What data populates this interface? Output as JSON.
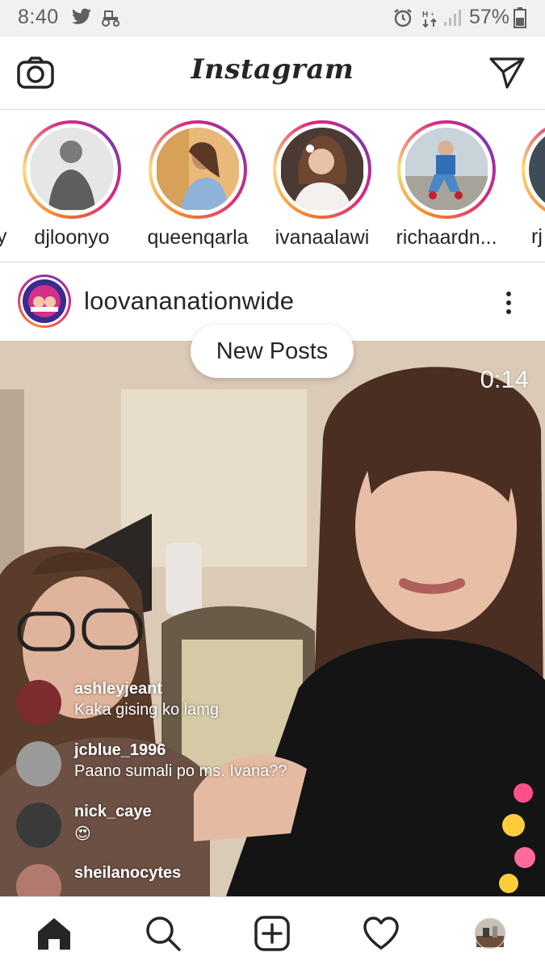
{
  "status_bar": {
    "time": "8:40",
    "battery": "57%",
    "icons": [
      "twitter-icon",
      "tractor-icon",
      "alarm-icon",
      "data-arrows-icon",
      "signal-icon",
      "battery-icon"
    ]
  },
  "header": {
    "brand": "Instagram",
    "left_icon": "camera-icon",
    "right_icon": "direct-message-icon"
  },
  "stories": {
    "partial_left_name": "y",
    "items": [
      {
        "username": "djloonyo"
      },
      {
        "username": "queenqarla"
      },
      {
        "username": "ivanaalawi"
      },
      {
        "username": "richaardn..."
      }
    ],
    "partial_right_name": "rj"
  },
  "post": {
    "username": "loovananationwide",
    "new_posts_label": "New Posts",
    "video_timer": "0:14",
    "live_comments": [
      {
        "user": "ashleyjeant",
        "text": "Kaka gising ko lamg"
      },
      {
        "user": "jcblue_1996",
        "text": "Paano sumali po ms. Ivana??"
      },
      {
        "user": "nick_caye",
        "text": "😍"
      },
      {
        "user": "sheilanocytes",
        "text": ""
      }
    ]
  },
  "bottom_nav": {
    "items": [
      "home-icon",
      "search-icon",
      "add-post-icon",
      "activity-heart-icon",
      "profile-avatar"
    ]
  },
  "colors": {
    "story_ring_start": "#f58529",
    "story_ring_mid": "#dd2a7b",
    "story_ring_end": "#8134af",
    "border": "#dbdbdb",
    "text": "#262626"
  }
}
